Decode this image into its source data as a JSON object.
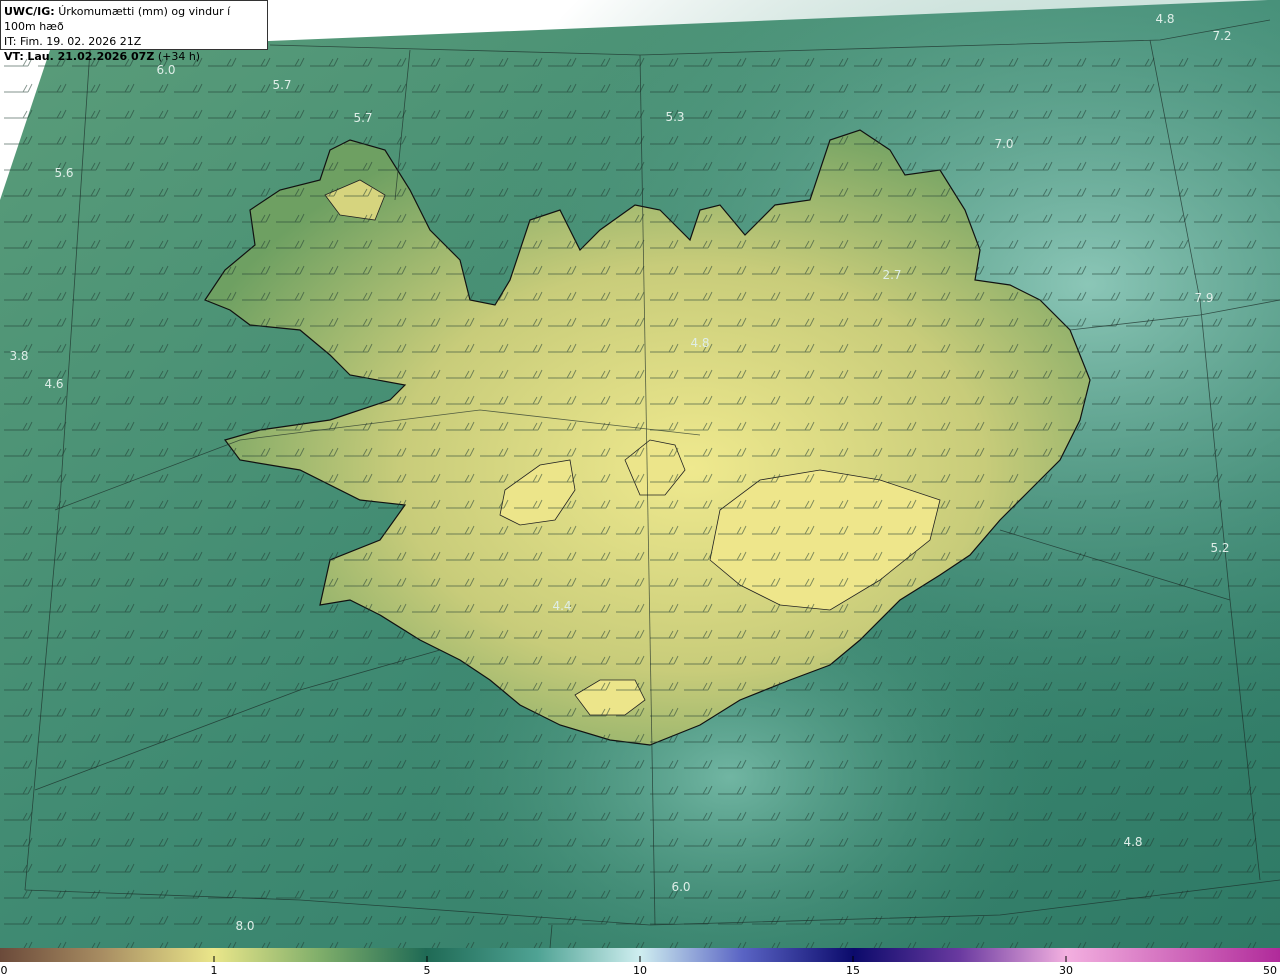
{
  "header": {
    "model": "UWC/IG:",
    "title": "Úrkomumætti (mm) og vindur í 100m hæð",
    "it_line": "IT: Fim. 19. 02. 2026 21Z",
    "vt_prefix": "VT:",
    "vt_bold": "Lau. 21.02.2026 07Z",
    "vt_suffix": "(+34 h)"
  },
  "map_labels": [
    {
      "id": "l1",
      "text": "4.8"
    },
    {
      "id": "l2",
      "text": "7.2"
    },
    {
      "id": "l3",
      "text": "6.0"
    },
    {
      "id": "l4",
      "text": "5.7"
    },
    {
      "id": "l5",
      "text": "5.7"
    },
    {
      "id": "l6",
      "text": "5.3"
    },
    {
      "id": "l7",
      "text": "7.0"
    },
    {
      "id": "l8",
      "text": "5.6"
    },
    {
      "id": "l9",
      "text": "2.7"
    },
    {
      "id": "l10",
      "text": "7.9"
    },
    {
      "id": "l11",
      "text": "3.8"
    },
    {
      "id": "l12",
      "text": "4.6"
    },
    {
      "id": "l13",
      "text": "4.8"
    },
    {
      "id": "l14",
      "text": "5.2"
    },
    {
      "id": "l15",
      "text": "4.4"
    },
    {
      "id": "l16",
      "text": "4.8"
    },
    {
      "id": "l17",
      "text": "6.0"
    },
    {
      "id": "l18",
      "text": "8.0"
    }
  ],
  "colorbar": {
    "ticks": [
      "0",
      "1",
      "5",
      "10",
      "15",
      "30",
      "50"
    ],
    "colors": [
      "#6b4a3a",
      "#c9b27a",
      "#eae68a",
      "#1f6a55",
      "#cfeef0",
      "#0b0a6b",
      "#f3b0e0",
      "#b02a9a"
    ]
  },
  "colors": {
    "sea": "#3f8a72",
    "land_low": "#7fa964",
    "land_high": "#e8e58a",
    "coast": "#111111"
  }
}
